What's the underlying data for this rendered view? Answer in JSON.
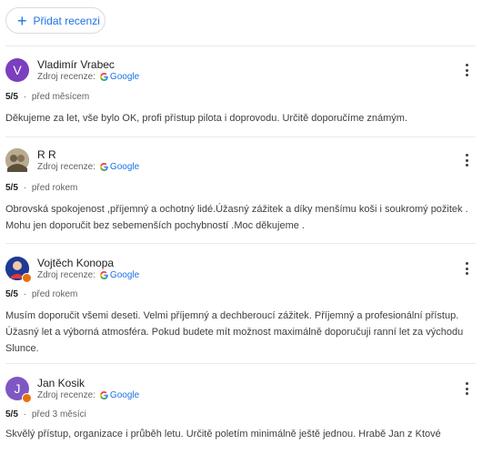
{
  "add_review": {
    "label": "Přidat recenzi",
    "icon": "plus-icon"
  },
  "colors": {
    "accent": "#1a73e8",
    "divider": "#e8eaed",
    "badge": "#e8710a"
  },
  "reviews": [
    {
      "name": "Vladimír Vrabec",
      "avatar_letter": "V",
      "avatar_color": "#7b3fbf",
      "source_label": "Zdroj recenze:",
      "source_name": "Google",
      "score": "5/5",
      "sep": "·",
      "time": "před měsícem",
      "text": "Děkujeme za let, vše bylo OK, profi přístup pilota i doprovodu. Určitě doporučíme známým."
    },
    {
      "name": "R R",
      "avatar_letter": "",
      "avatar_color": "#9c8f78",
      "source_label": "Zdroj recenze:",
      "source_name": "Google",
      "score": "5/5",
      "sep": "·",
      "time": "před rokem",
      "text": "Obrovská spokojenost ,příjemný a ochotný lidé.Úžasný zážitek a díky menšímu koši i soukromý požitek . Mohu jen doporučit bez sebemenších pochybností .Moc děkujeme ."
    },
    {
      "name": "Vojtěch Konopa",
      "avatar_letter": "",
      "avatar_color": "#1f3a93",
      "source_label": "Zdroj recenze:",
      "source_name": "Google",
      "score": "5/5",
      "sep": "·",
      "time": "před rokem",
      "text": "Musím doporučit všemi deseti. Velmi příjemný a dechberoucí zážitek. Příjemný a profesionální přístup. Úžasný let a výborná atmosféra. Pokud budete mít možnost maximálně doporučuji ranní let za východu Slunce."
    },
    {
      "name": "Jan Kosik",
      "avatar_letter": "J",
      "avatar_color": "#7e57c2",
      "source_label": "Zdroj recenze:",
      "source_name": "Google",
      "score": "5/5",
      "sep": "·",
      "time": "před 3 měsíci",
      "text": "Skvělý přístup, organizace i průběh letu. Určitě poletím minimálně ještě jednou. Hrabě Jan z Ktové"
    }
  ]
}
